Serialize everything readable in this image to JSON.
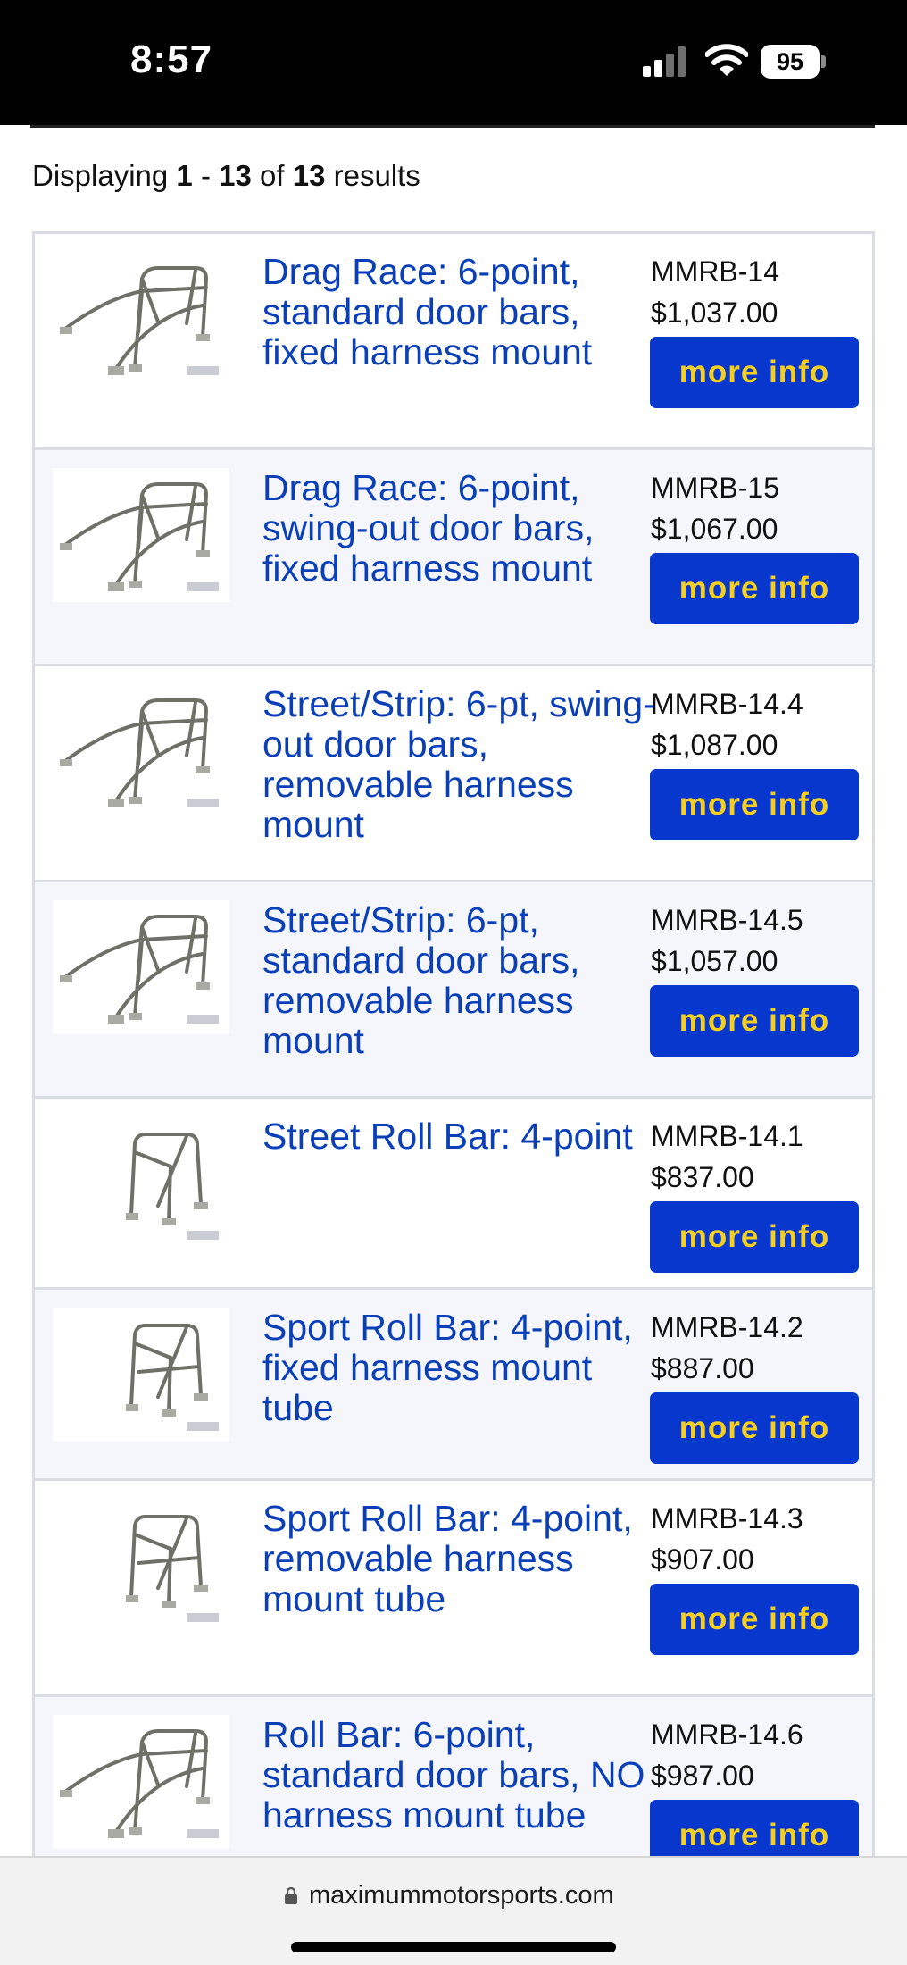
{
  "status_bar": {
    "time": "8:57",
    "battery": "95"
  },
  "results": {
    "prefix": "Displaying",
    "start": "1",
    "dash": "-",
    "end": "13",
    "of": "of",
    "total": "13",
    "suffix": "results"
  },
  "products": [
    {
      "name": "Drag Race: 6-point, standard door bars, fixed harness mount",
      "sku": "MMRB-14",
      "price": "$1,037.00",
      "button": "more info",
      "image": "six-point-cage"
    },
    {
      "name": "Drag Race: 6-point, swing-out door bars, fixed harness mount",
      "sku": "MMRB-15",
      "price": "$1,067.00",
      "button": "more info",
      "image": "six-point-cage"
    },
    {
      "name": "Street/Strip: 6-pt, swing-out door bars, removable harness mount",
      "sku": "MMRB-14.4",
      "price": "$1,087.00",
      "button": "more info",
      "image": "six-point-cage"
    },
    {
      "name": "Street/Strip: 6-pt, standard door bars, removable harness mount",
      "sku": "MMRB-14.5",
      "price": "$1,057.00",
      "button": "more info",
      "image": "six-point-cage"
    },
    {
      "name": "Street Roll Bar: 4-point",
      "sku": "MMRB-14.1",
      "price": "$837.00",
      "button": "more info",
      "image": "four-point-bar"
    },
    {
      "name": "Sport Roll Bar: 4-point, fixed harness mount tube",
      "sku": "MMRB-14.2",
      "price": "$887.00",
      "button": "more info",
      "image": "four-point-bar"
    },
    {
      "name": "Sport Roll Bar: 4-point, removable harness mount tube",
      "sku": "MMRB-14.3",
      "price": "$907.00",
      "button": "more info",
      "image": "four-point-bar"
    },
    {
      "name": "Roll Bar: 6-point, standard door bars, NO harness mount tube",
      "sku": "MMRB-14.6",
      "price": "$987.00",
      "button": "more info",
      "image": "six-point-cage"
    }
  ],
  "browser": {
    "url": "maximummotorsports.com"
  },
  "colors": {
    "link": "#0a3fb8",
    "button_bg": "#0737cc",
    "button_text": "#f5cf20",
    "row_alt": "#f4f6fb"
  }
}
